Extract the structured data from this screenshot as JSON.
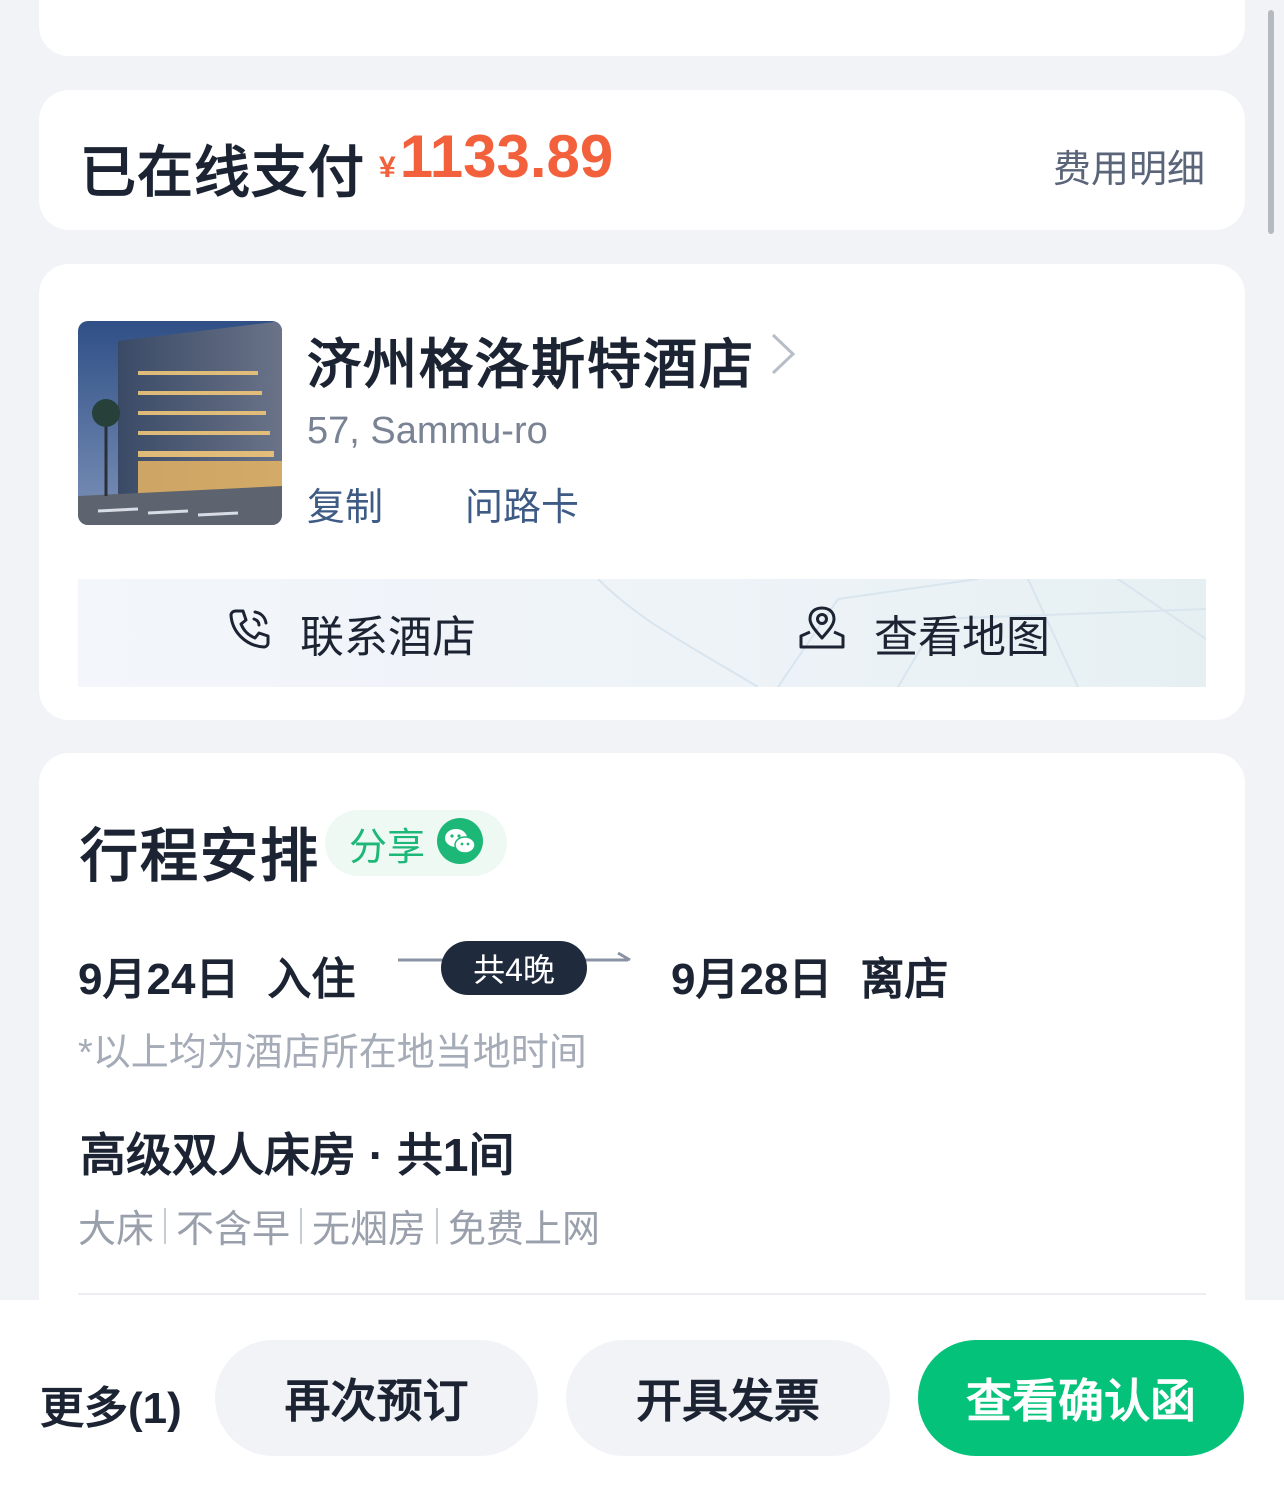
{
  "payment": {
    "label": "已在线支付",
    "currency": "¥",
    "amount": "1133.89",
    "detail_link": "费用明细",
    "accent": "#f2603c"
  },
  "hotel": {
    "name": "济州格洛斯特酒店",
    "address": "57, Sammu-ro",
    "copy_label": "复制",
    "route_card_label": "问路卡",
    "contact_label": "联系酒店",
    "map_label": "查看地图"
  },
  "itinerary": {
    "title": "行程安排",
    "share_label": "分享",
    "checkin_date": "9月24日",
    "checkin_label": "入住",
    "nights": "共4晚",
    "checkout_date": "9月28日",
    "checkout_label": "离店",
    "note": "*以上均为酒店所在地当地时间",
    "room_title": "高级双人床房 · 共1间",
    "room_tags": [
      "大床",
      "不含早",
      "无烟房",
      "免费上网"
    ]
  },
  "actions": {
    "more": "更多(1)",
    "rebook": "再次预订",
    "invoice": "开具发票",
    "confirmation": "查看确认函",
    "primary_color": "#05c27a"
  }
}
